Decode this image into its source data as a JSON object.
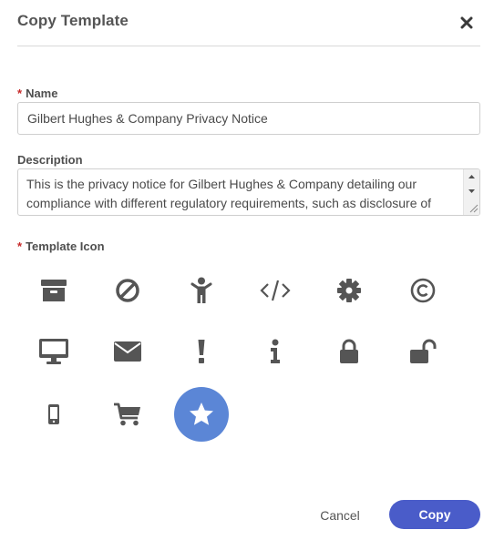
{
  "dialog": {
    "title": "Copy Template",
    "close_icon": "close-icon"
  },
  "name_field": {
    "required_marker": "*",
    "label": "Name",
    "value": "Gilbert Hughes & Company Privacy Notice"
  },
  "description_field": {
    "label": "Description",
    "value": "This is the privacy notice for Gilbert Hughes & Company detailing our compliance with different regulatory requirements, such as disclosure of"
  },
  "icon_picker": {
    "required_marker": "*",
    "label": "Template Icon",
    "icon_color": "#555555",
    "selected_color": "#5b86d6",
    "selected_icon": "star-icon",
    "icons": [
      "archive-icon",
      "ban-icon",
      "child-icon",
      "code-icon",
      "gear-icon",
      "copyright-icon",
      "desktop-icon",
      "envelope-icon",
      "exclamation-icon",
      "info-icon",
      "lock-icon",
      "unlock-icon",
      "mobile-icon",
      "cart-icon",
      "star-icon"
    ]
  },
  "footer": {
    "cancel_label": "Cancel",
    "copy_label": "Copy",
    "primary_color": "#4a5cc9"
  }
}
